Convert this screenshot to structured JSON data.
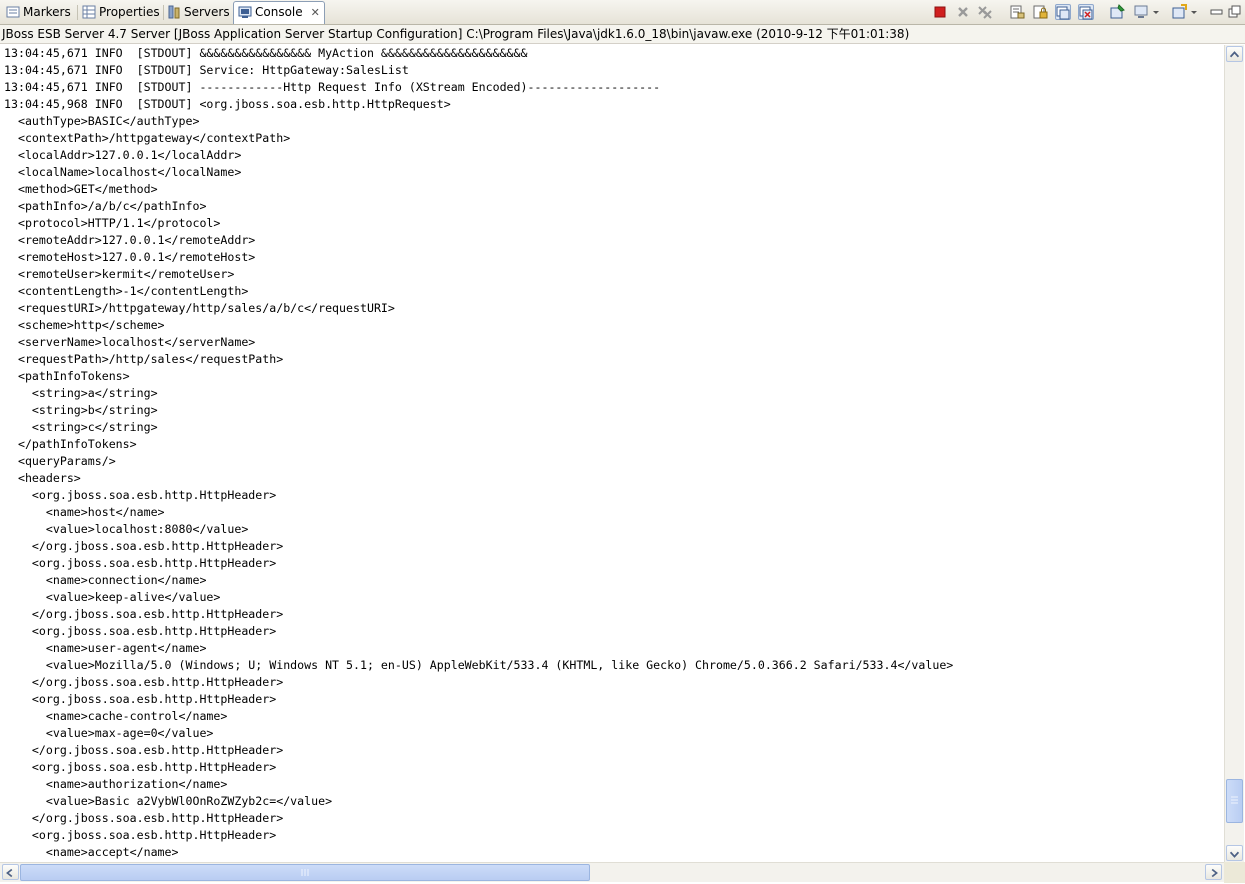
{
  "tabs": [
    {
      "label": "Markers",
      "icon": "markers-icon",
      "active": false
    },
    {
      "label": "Properties",
      "icon": "properties-icon",
      "active": false
    },
    {
      "label": "Servers",
      "icon": "servers-icon",
      "active": false
    },
    {
      "label": "Console",
      "icon": "console-icon",
      "active": true,
      "close": "✕"
    }
  ],
  "toolbar": [
    "terminate-icon",
    "remove-launch-icon",
    "remove-all-terminated-icon",
    "clear-console-icon",
    "scroll-lock-icon",
    "show-console-on-stdout-icon",
    "show-console-on-stderr-icon",
    "pin-console-icon",
    "display-selected-console-icon",
    "open-console-icon",
    "minimize-icon",
    "maximize-icon"
  ],
  "console_title": "JBoss ESB Server 4.7 Server [JBoss Application Server Startup Configuration] C:\\Program Files\\Java\\jdk1.6.0_18\\bin\\javaw.exe (2010-9-12 下午01:01:38)",
  "console_lines": [
    "13:04:45,671 INFO  [STDOUT] &&&&&&&&&&&&&&&& MyAction &&&&&&&&&&&&&&&&&&&&&",
    "13:04:45,671 INFO  [STDOUT] Service: HttpGateway:SalesList",
    "13:04:45,671 INFO  [STDOUT] ------------Http Request Info (XStream Encoded)-------------------",
    "13:04:45,968 INFO  [STDOUT] <org.jboss.soa.esb.http.HttpRequest>",
    "  <authType>BASIC</authType>",
    "  <contextPath>/httpgateway</contextPath>",
    "  <localAddr>127.0.0.1</localAddr>",
    "  <localName>localhost</localName>",
    "  <method>GET</method>",
    "  <pathInfo>/a/b/c</pathInfo>",
    "  <protocol>HTTP/1.1</protocol>",
    "  <remoteAddr>127.0.0.1</remoteAddr>",
    "  <remoteHost>127.0.0.1</remoteHost>",
    "  <remoteUser>kermit</remoteUser>",
    "  <contentLength>-1</contentLength>",
    "  <requestURI>/httpgateway/http/sales/a/b/c</requestURI>",
    "  <scheme>http</scheme>",
    "  <serverName>localhost</serverName>",
    "  <requestPath>/http/sales</requestPath>",
    "  <pathInfoTokens>",
    "    <string>a</string>",
    "    <string>b</string>",
    "    <string>c</string>",
    "  </pathInfoTokens>",
    "  <queryParams/>",
    "  <headers>",
    "    <org.jboss.soa.esb.http.HttpHeader>",
    "      <name>host</name>",
    "      <value>localhost:8080</value>",
    "    </org.jboss.soa.esb.http.HttpHeader>",
    "    <org.jboss.soa.esb.http.HttpHeader>",
    "      <name>connection</name>",
    "      <value>keep-alive</value>",
    "    </org.jboss.soa.esb.http.HttpHeader>",
    "    <org.jboss.soa.esb.http.HttpHeader>",
    "      <name>user-agent</name>",
    "      <value>Mozilla/5.0 (Windows; U; Windows NT 5.1; en-US) AppleWebKit/533.4 (KHTML, like Gecko) Chrome/5.0.366.2 Safari/533.4</value>",
    "    </org.jboss.soa.esb.http.HttpHeader>",
    "    <org.jboss.soa.esb.http.HttpHeader>",
    "      <name>cache-control</name>",
    "      <value>max-age=0</value>",
    "    </org.jboss.soa.esb.http.HttpHeader>",
    "    <org.jboss.soa.esb.http.HttpHeader>",
    "      <name>authorization</name>",
    "      <value>Basic a2VybWl0OnRoZWZyb2c=</value>",
    "    </org.jboss.soa.esb.http.HttpHeader>",
    "    <org.jboss.soa.esb.http.HttpHeader>",
    "      <name>accept</name>"
  ],
  "colors": {
    "terminate": "#d01f1f",
    "selection": "#316ac5",
    "scroll_thumb": "#c1d2f5"
  }
}
